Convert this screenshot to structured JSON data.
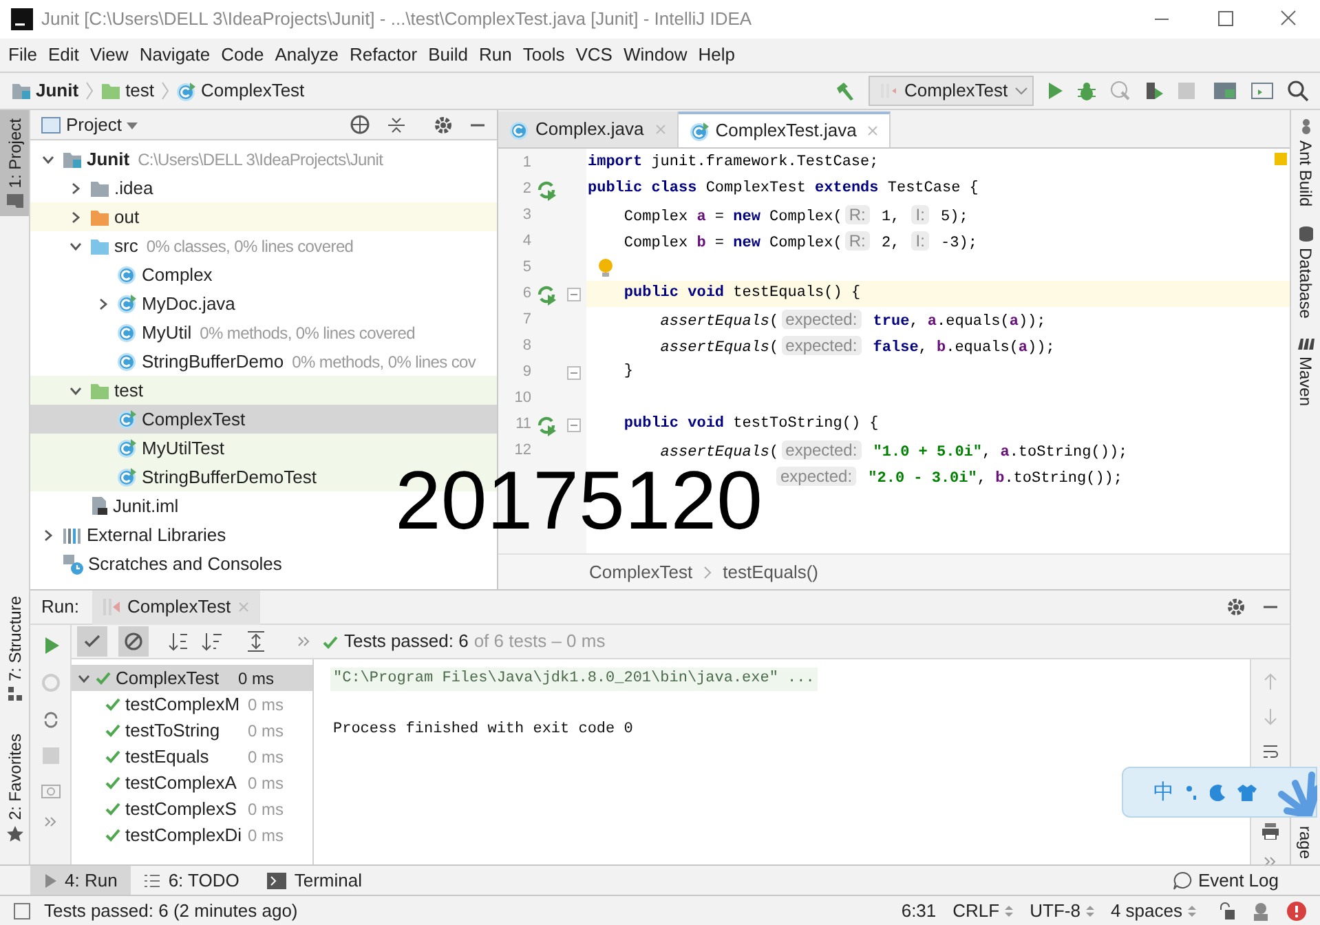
{
  "window": {
    "title": "Junit [C:\\Users\\DELL 3\\IdeaProjects\\Junit] - ...\\test\\ComplexTest.java [Junit] - IntelliJ IDEA"
  },
  "menu": [
    "File",
    "Edit",
    "View",
    "Navigate",
    "Code",
    "Analyze",
    "Refactor",
    "Build",
    "Run",
    "Tools",
    "VCS",
    "Window",
    "Help"
  ],
  "breadcrumbs": [
    {
      "kind": "module",
      "label": "Junit"
    },
    {
      "kind": "test-folder",
      "label": "test"
    },
    {
      "kind": "test-class",
      "label": "ComplexTest"
    }
  ],
  "run_config": {
    "label": "ComplexTest"
  },
  "left_stripe": {
    "top": [
      {
        "label": "1: Project",
        "selected": true
      }
    ],
    "bottom": [
      {
        "label": "7: Structure",
        "selected": false
      },
      {
        "label": "2: Favorites",
        "selected": false
      }
    ]
  },
  "project_panel": {
    "title": "Project",
    "tree": [
      {
        "kind": "module",
        "label": "Junit",
        "hint": "C:\\Users\\DELL 3\\IdeaProjects\\Junit",
        "expanded": true,
        "selected": false,
        "children": [
          {
            "kind": "folder",
            "label": ".idea",
            "expanded": false,
            "selected": false
          },
          {
            "kind": "excluded-folder",
            "label": "out",
            "expanded": false,
            "selected": false
          },
          {
            "kind": "source-folder",
            "label": "src",
            "hint": "0% classes, 0% lines covered",
            "expanded": true,
            "selected": false,
            "children": [
              {
                "kind": "class",
                "label": "Complex",
                "selected": false
              },
              {
                "kind": "test-class",
                "label": "MyDoc.java",
                "expanded": false,
                "selected": false
              },
              {
                "kind": "class",
                "label": "MyUtil",
                "hint": "0% methods, 0% lines covered",
                "selected": false
              },
              {
                "kind": "class",
                "label": "StringBufferDemo",
                "hint": "0% methods, 0% lines cov",
                "selected": false
              }
            ]
          },
          {
            "kind": "test-folder",
            "label": "test",
            "expanded": true,
            "selected": false,
            "children": [
              {
                "kind": "test-class",
                "label": "ComplexTest",
                "selected": true
              },
              {
                "kind": "test-class",
                "label": "MyUtilTest",
                "selected": false
              },
              {
                "kind": "test-class",
                "label": "StringBufferDemoTest",
                "selected": false
              }
            ]
          },
          {
            "kind": "iml-file",
            "label": "Junit.iml",
            "selected": false
          }
        ]
      },
      {
        "kind": "libraries",
        "label": "External Libraries",
        "expanded": false,
        "selected": false
      },
      {
        "kind": "scratches",
        "label": "Scratches and Consoles",
        "selected": false
      }
    ]
  },
  "editor": {
    "tabs": [
      {
        "label": "Complex.java",
        "kind": "class",
        "selected": false
      },
      {
        "label": "ComplexTest.java",
        "kind": "test-class",
        "selected": true
      }
    ],
    "lines": [
      {
        "number": "1",
        "tokens": [
          {
            "kind": "keyword",
            "text": "import"
          },
          {
            "kind": "plain",
            "text": " junit.framework.TestCase;"
          }
        ]
      },
      {
        "number": "2",
        "runnable": true,
        "tokens": [
          {
            "kind": "keyword",
            "text": "public class"
          },
          {
            "kind": "plain",
            "text": " ComplexTest "
          },
          {
            "kind": "keyword",
            "text": "extends"
          },
          {
            "kind": "plain",
            "text": " TestCase {"
          }
        ]
      },
      {
        "number": "3",
        "tokens": [
          {
            "kind": "plain",
            "text": "    Complex "
          },
          {
            "kind": "field",
            "text": "a"
          },
          {
            "kind": "plain",
            "text": " = "
          },
          {
            "kind": "keyword",
            "text": "new"
          },
          {
            "kind": "plain",
            "text": " Complex("
          },
          {
            "kind": "hint",
            "text": "R:"
          },
          {
            "kind": "plain",
            "text": " 1, "
          },
          {
            "kind": "hint",
            "text": "I:"
          },
          {
            "kind": "plain",
            "text": " 5);"
          }
        ]
      },
      {
        "number": "4",
        "tokens": [
          {
            "kind": "plain",
            "text": "    Complex "
          },
          {
            "kind": "field",
            "text": "b"
          },
          {
            "kind": "plain",
            "text": " = "
          },
          {
            "kind": "keyword",
            "text": "new"
          },
          {
            "kind": "plain",
            "text": " Complex("
          },
          {
            "kind": "hint",
            "text": "R:"
          },
          {
            "kind": "plain",
            "text": " 2, "
          },
          {
            "kind": "hint",
            "text": "I:"
          },
          {
            "kind": "plain",
            "text": " -3);"
          }
        ]
      },
      {
        "number": "5",
        "bulb": true
      },
      {
        "number": "6",
        "runnable": true,
        "fold": true,
        "current": true,
        "tokens": [
          {
            "kind": "keyword",
            "text": "    public void"
          },
          {
            "kind": "plain",
            "text": " testEquals() {"
          }
        ]
      },
      {
        "number": "7",
        "tokens": [
          {
            "kind": "method",
            "text": "        assertEquals"
          },
          {
            "kind": "plain",
            "text": "("
          },
          {
            "kind": "hint",
            "text": "expected:"
          },
          {
            "kind": "keyword",
            "text": " true"
          },
          {
            "kind": "plain",
            "text": ", "
          },
          {
            "kind": "field",
            "text": "a"
          },
          {
            "kind": "plain",
            "text": ".equals("
          },
          {
            "kind": "field",
            "text": "a"
          },
          {
            "kind": "plain",
            "text": "));"
          }
        ]
      },
      {
        "number": "8",
        "tokens": [
          {
            "kind": "method",
            "text": "        assertEquals"
          },
          {
            "kind": "plain",
            "text": "("
          },
          {
            "kind": "hint",
            "text": "expected:"
          },
          {
            "kind": "keyword",
            "text": " false"
          },
          {
            "kind": "plain",
            "text": ", "
          },
          {
            "kind": "field",
            "text": "b"
          },
          {
            "kind": "plain",
            "text": ".equals("
          },
          {
            "kind": "field",
            "text": "a"
          },
          {
            "kind": "plain",
            "text": "));"
          }
        ]
      },
      {
        "number": "9",
        "fold": true,
        "tokens": [
          {
            "kind": "plain",
            "text": "    }"
          }
        ]
      },
      {
        "number": "10"
      },
      {
        "number": "11",
        "runnable": true,
        "fold": true,
        "tokens": [
          {
            "kind": "keyword",
            "text": "    public void"
          },
          {
            "kind": "plain",
            "text": " testToString() {"
          }
        ]
      },
      {
        "number": "12",
        "tokens": [
          {
            "kind": "method",
            "text": "        assertEquals"
          },
          {
            "kind": "plain",
            "text": "("
          },
          {
            "kind": "hint",
            "text": "expected:"
          },
          {
            "kind": "string",
            "text": " \"1.0 + 5.0i\""
          },
          {
            "kind": "plain",
            "text": ", "
          },
          {
            "kind": "field",
            "text": "a"
          },
          {
            "kind": "plain",
            "text": ".toString());"
          }
        ]
      },
      {
        "kind": "partial",
        "tokens": [
          {
            "kind": "hint",
            "text": "expected:"
          },
          {
            "kind": "string",
            "text": " \"2.0 - 3.0i\""
          },
          {
            "kind": "plain",
            "text": ", "
          },
          {
            "kind": "field",
            "text": "b"
          },
          {
            "kind": "plain",
            "text": ".toString());"
          }
        ]
      }
    ],
    "breadcrumbs": [
      "ComplexTest",
      "testEquals()"
    ]
  },
  "right_stripe": [
    {
      "label": "Ant Build",
      "kind": "ant"
    },
    {
      "label": "Database",
      "kind": "database"
    },
    {
      "label": "Maven",
      "kind": "maven"
    },
    {
      "label": "rage"
    }
  ],
  "run_panel": {
    "label": "Run:",
    "tab": "ComplexTest",
    "status": "Tests passed: 6",
    "status_detail": "of 6 tests – 0 ms",
    "tests": [
      {
        "name": "ComplexTest",
        "time": "0 ms",
        "passed": true,
        "expanded": true,
        "selected": true,
        "children": [
          {
            "name": "testComplexM",
            "time": "0 ms",
            "passed": true,
            "selected": false
          },
          {
            "name": "testToString",
            "time": "0 ms",
            "passed": true,
            "selected": false
          },
          {
            "name": "testEquals",
            "time": "0 ms",
            "passed": true,
            "selected": false
          },
          {
            "name": "testComplexA",
            "time": "0 ms",
            "passed": true,
            "selected": false
          },
          {
            "name": "testComplexS",
            "time": "0 ms",
            "passed": true,
            "selected": false
          },
          {
            "name": "testComplexDi",
            "time": "0 ms",
            "passed": true,
            "selected": false
          }
        ]
      }
    ],
    "console": [
      {
        "kind": "command",
        "text": "\"C:\\Program Files\\Java\\jdk1.8.0_201\\bin\\java.exe\" ..."
      },
      {
        "kind": "output",
        "text": "Process finished with exit code 0"
      }
    ]
  },
  "tool_tabs": [
    {
      "label": "4: Run",
      "kind": "run",
      "selected": true
    },
    {
      "label": "6: TODO",
      "kind": "todo",
      "selected": false
    },
    {
      "label": "Terminal",
      "kind": "terminal",
      "selected": false
    }
  ],
  "event_log": "Event Log",
  "status_bar": {
    "message": "Tests passed: 6 (2 minutes ago)",
    "items": [
      {
        "label": "6:31",
        "dropdown": false
      },
      {
        "label": "CRLF",
        "dropdown": true
      },
      {
        "label": "UTF-8",
        "dropdown": true
      },
      {
        "label": "4 spaces",
        "dropdown": true
      }
    ]
  },
  "ime_toolbar": {
    "label": "中"
  },
  "overlay_text": "20175120"
}
